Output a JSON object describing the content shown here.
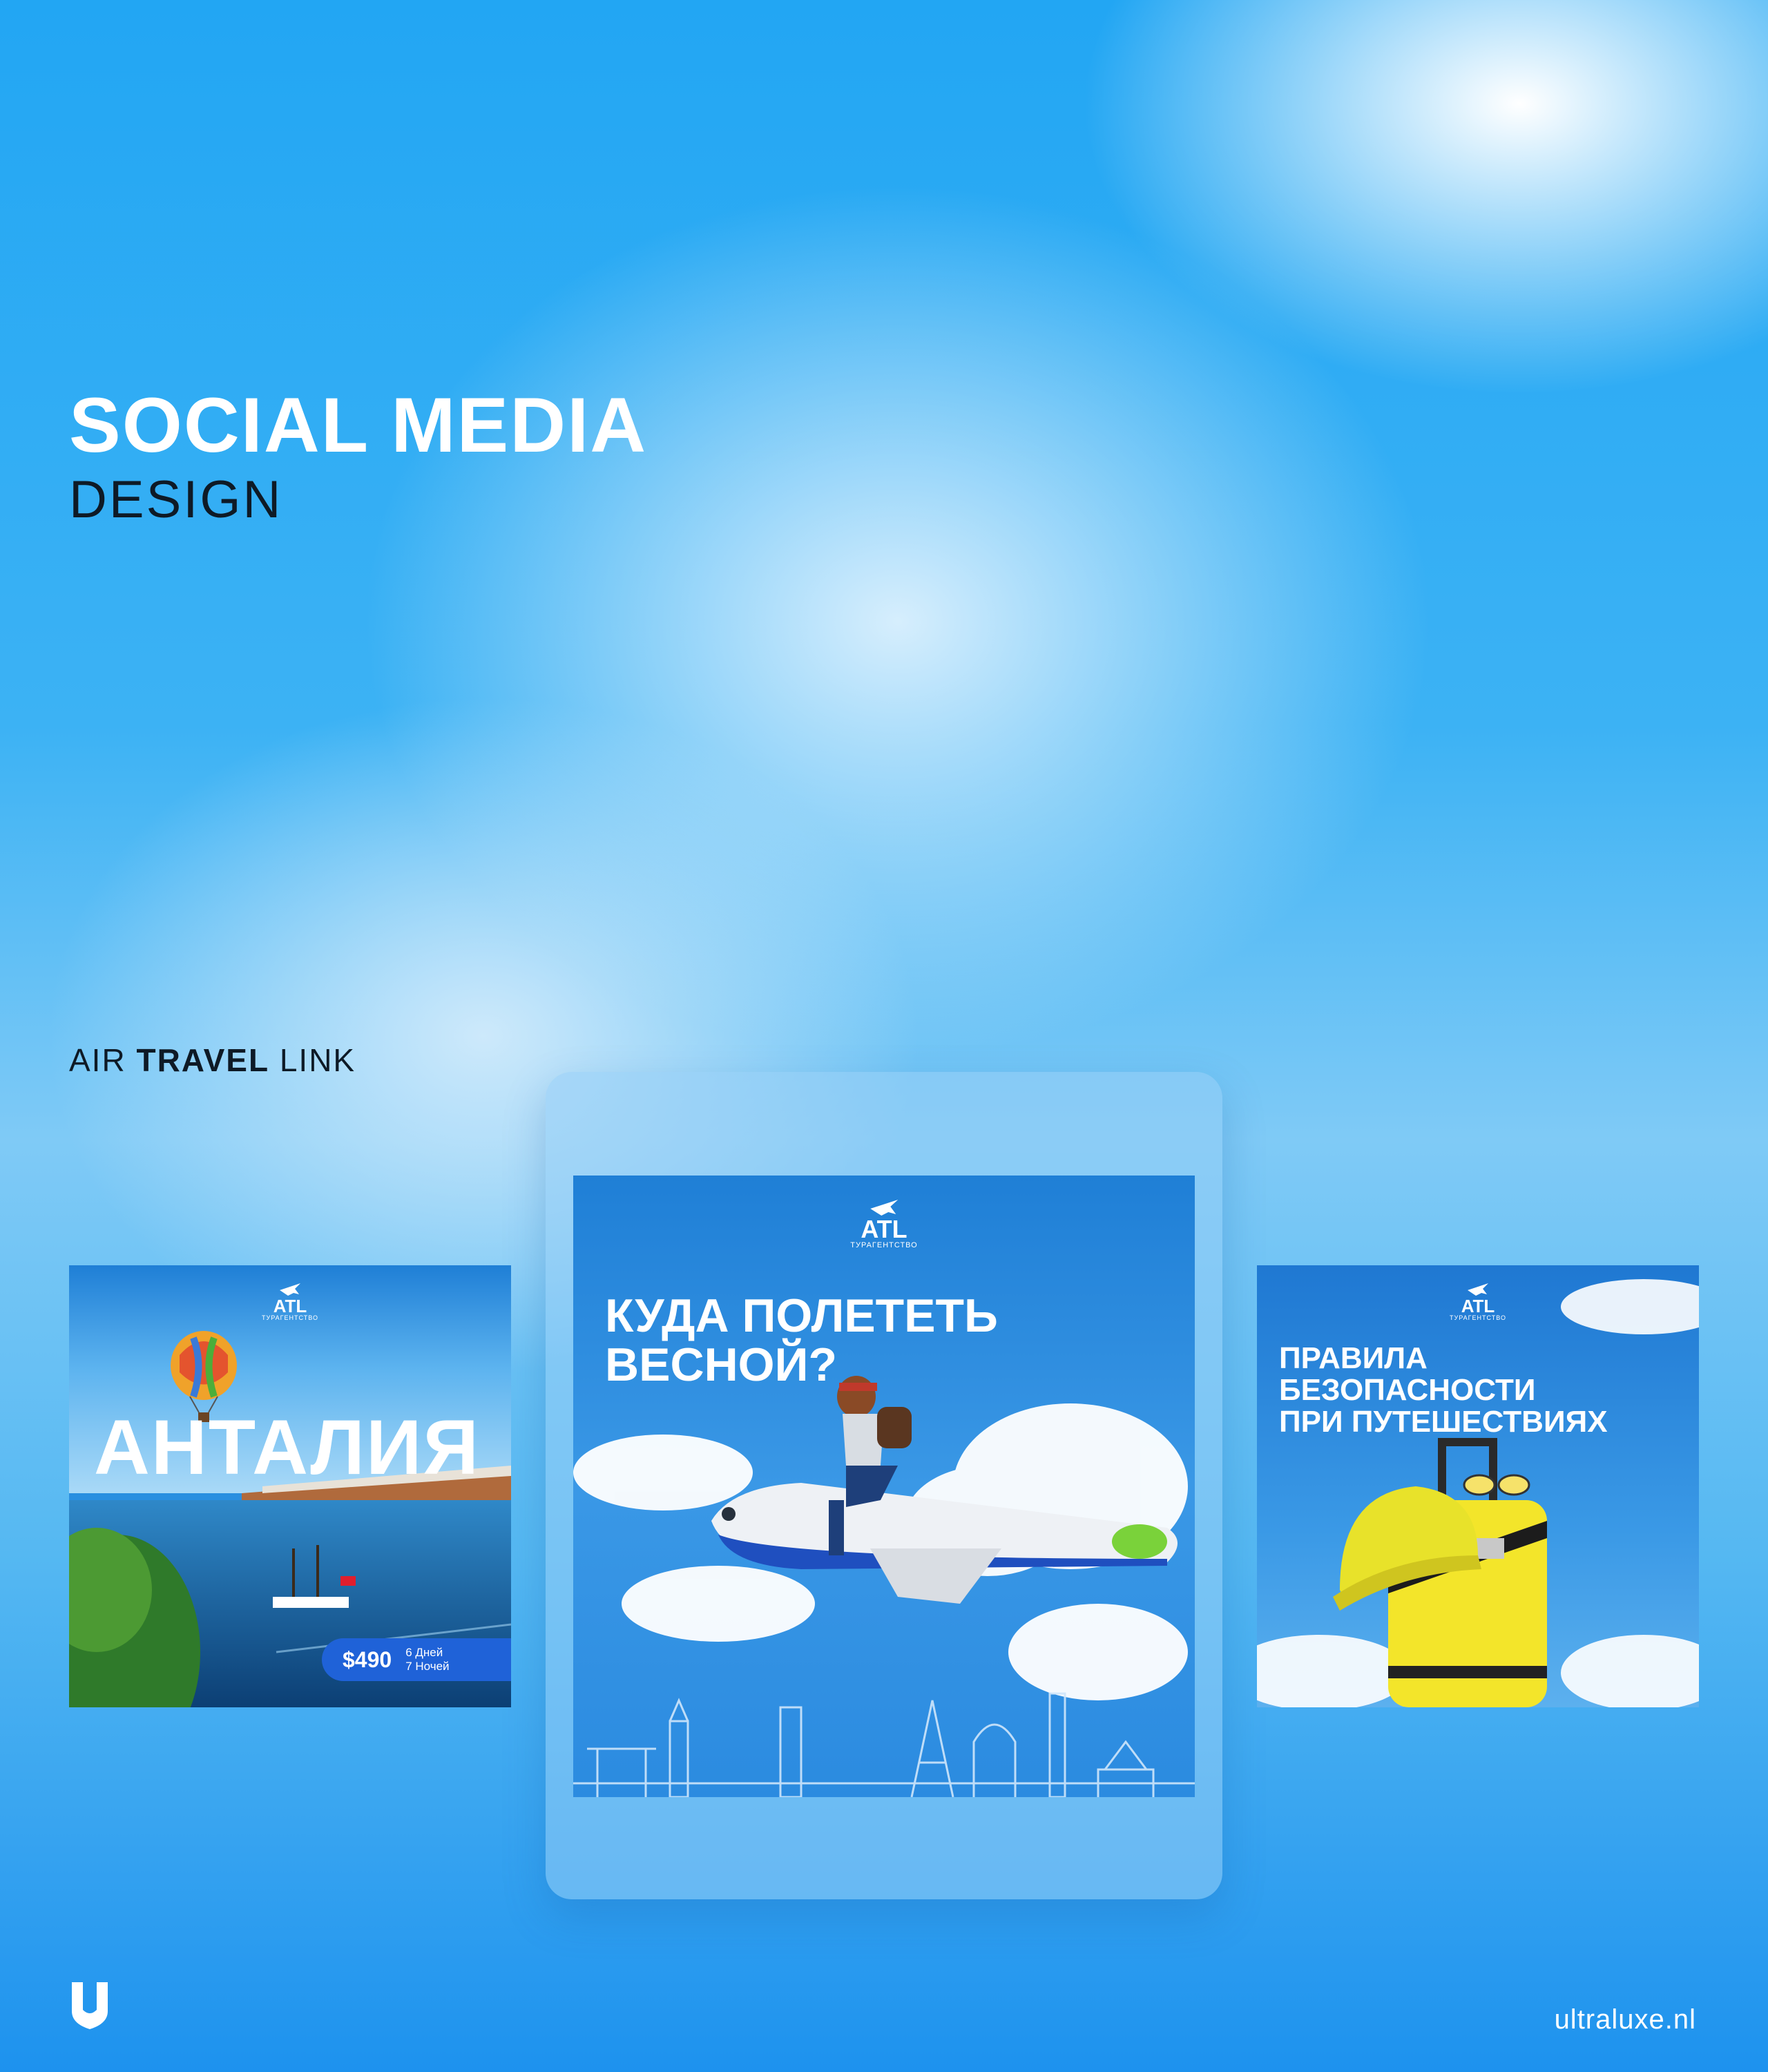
{
  "header": {
    "title": "SOCIAL MEDIA",
    "subtitle": "DESIGN"
  },
  "project": {
    "prefix": "AIR",
    "bold": "TRAVEL",
    "suffix": "LINK"
  },
  "logo": {
    "name": "ATL",
    "tagline": "ТУРАГЕНТСТВО"
  },
  "posts": [
    {
      "headline": "АНТАЛИЯ",
      "price": "$490",
      "days": "6 Дней",
      "nights": "7 Ночей"
    },
    {
      "headline_line1": "КУДА ПОЛЕТЕТЬ",
      "headline_line2": "ВЕСНОЙ?"
    },
    {
      "headline_line1": "ПРАВИЛА",
      "headline_line2": "БЕЗОПАСНОСТИ",
      "headline_line3": "ПРИ ПУТЕШЕСТВИЯХ"
    }
  ],
  "footer": {
    "url": "ultraluxe.nl"
  },
  "icons": [
    "plane-icon",
    "hot-air-balloon-icon",
    "ship-icon",
    "airplane-illustration",
    "suitcase-icon",
    "hard-hat-icon",
    "brand-u-icon"
  ],
  "colors": {
    "accent": "#1f62d8",
    "suitcase": "#f3e52a",
    "text_dark": "#0e1a26"
  }
}
